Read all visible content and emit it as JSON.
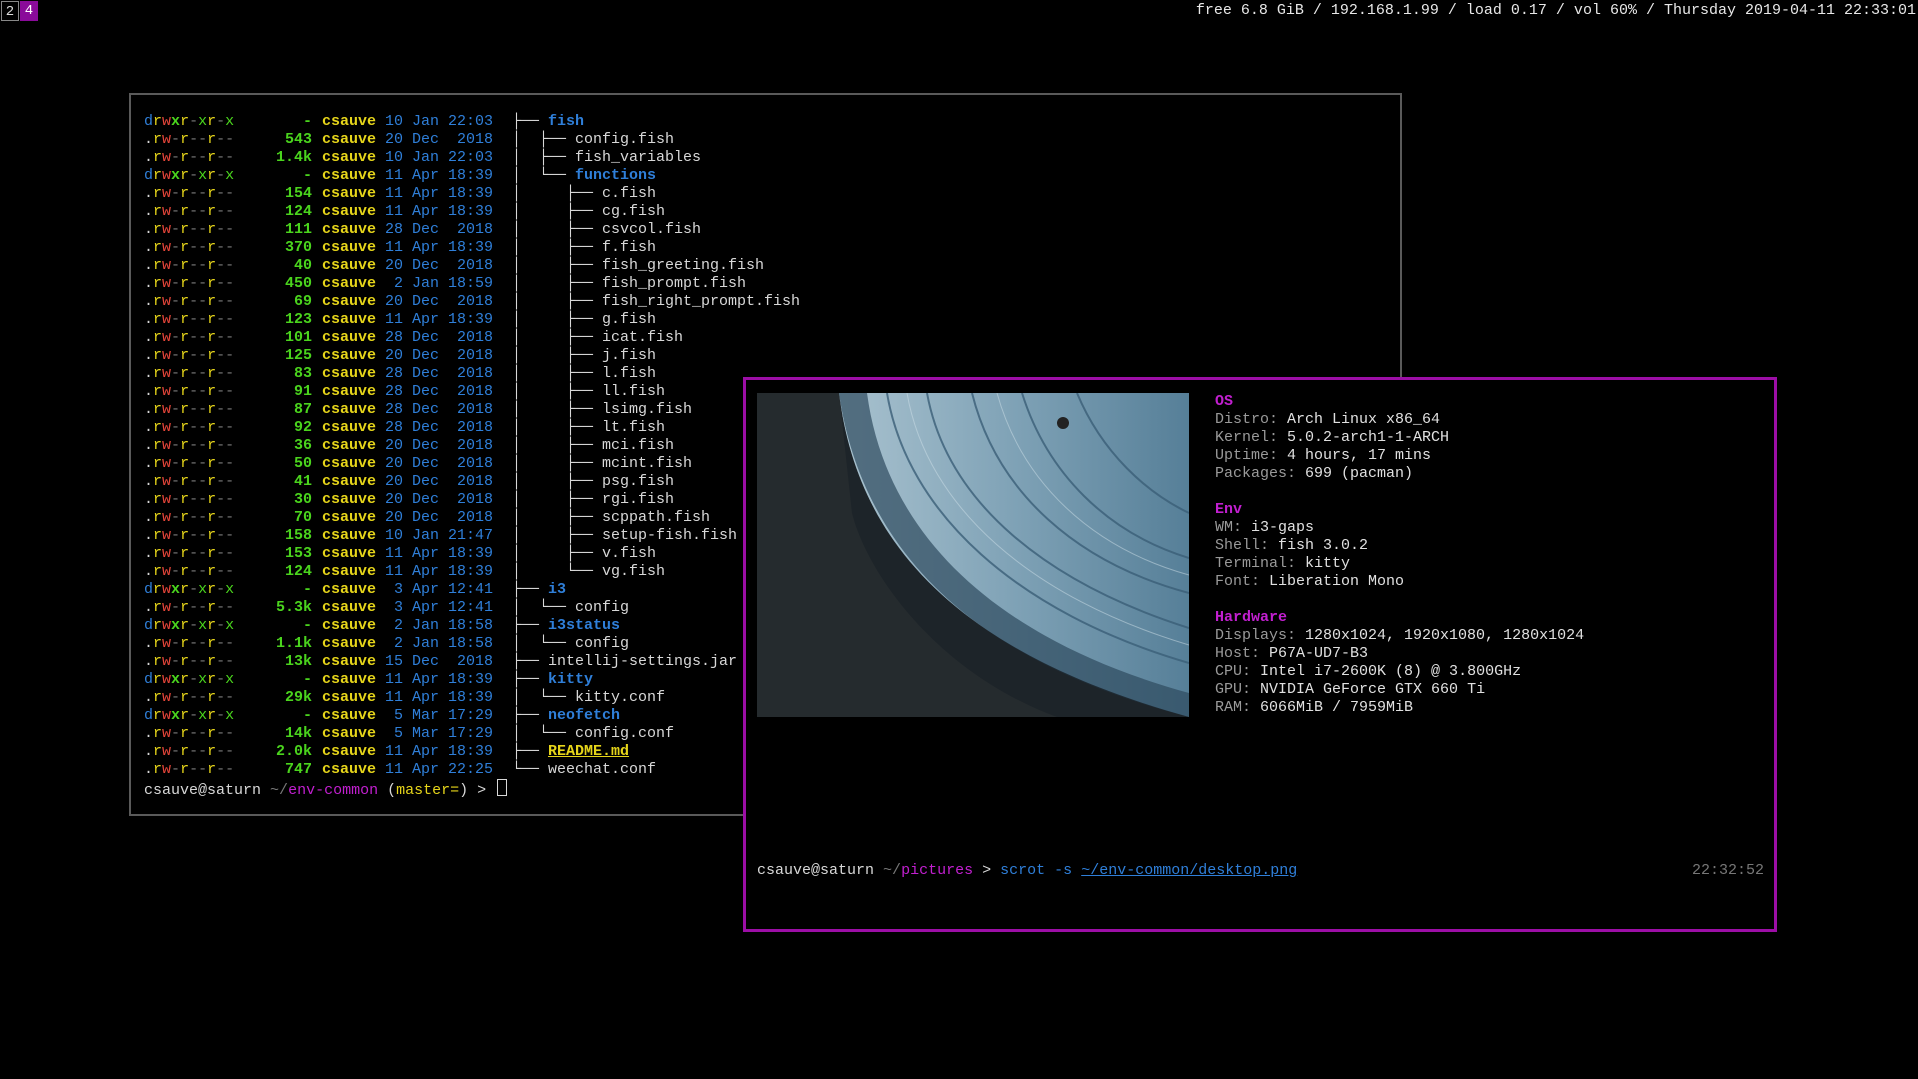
{
  "bar": {
    "workspaces": [
      "2",
      "4"
    ],
    "status": "free 6.8 GiB / 192.168.1.99 / load 0.17 / vol 60% / Thursday 2019-04-11 22:33:01"
  },
  "term1": {
    "rows": [
      {
        "perm": "drwxr-xr-x",
        "size": "-",
        "user": "csauve",
        "date": "10 Jan 22:03",
        "tree": "├── ",
        "name": "fish",
        "kind": "dir"
      },
      {
        "perm": ".rw-r--r--",
        "size": "543",
        "user": "csauve",
        "date": "20 Dec  2018",
        "tree": "│  ├── ",
        "name": "config.fish",
        "kind": "file"
      },
      {
        "perm": ".rw-r--r--",
        "size": "1.4k",
        "user": "csauve",
        "date": "10 Jan 22:03",
        "tree": "│  ├── ",
        "name": "fish_variables",
        "kind": "file"
      },
      {
        "perm": "drwxr-xr-x",
        "size": "-",
        "user": "csauve",
        "date": "11 Apr 18:39",
        "tree": "│  └── ",
        "name": "functions",
        "kind": "dir"
      },
      {
        "perm": ".rw-r--r--",
        "size": "154",
        "user": "csauve",
        "date": "11 Apr 18:39",
        "tree": "│     ├── ",
        "name": "c.fish",
        "kind": "file"
      },
      {
        "perm": ".rw-r--r--",
        "size": "124",
        "user": "csauve",
        "date": "11 Apr 18:39",
        "tree": "│     ├── ",
        "name": "cg.fish",
        "kind": "file"
      },
      {
        "perm": ".rw-r--r--",
        "size": "111",
        "user": "csauve",
        "date": "28 Dec  2018",
        "tree": "│     ├── ",
        "name": "csvcol.fish",
        "kind": "file"
      },
      {
        "perm": ".rw-r--r--",
        "size": "370",
        "user": "csauve",
        "date": "11 Apr 18:39",
        "tree": "│     ├── ",
        "name": "f.fish",
        "kind": "file"
      },
      {
        "perm": ".rw-r--r--",
        "size": "40",
        "user": "csauve",
        "date": "20 Dec  2018",
        "tree": "│     ├── ",
        "name": "fish_greeting.fish",
        "kind": "file"
      },
      {
        "perm": ".rw-r--r--",
        "size": "450",
        "user": "csauve",
        "date": " 2 Jan 18:59",
        "tree": "│     ├── ",
        "name": "fish_prompt.fish",
        "kind": "file"
      },
      {
        "perm": ".rw-r--r--",
        "size": "69",
        "user": "csauve",
        "date": "20 Dec  2018",
        "tree": "│     ├── ",
        "name": "fish_right_prompt.fish",
        "kind": "file"
      },
      {
        "perm": ".rw-r--r--",
        "size": "123",
        "user": "csauve",
        "date": "11 Apr 18:39",
        "tree": "│     ├── ",
        "name": "g.fish",
        "kind": "file"
      },
      {
        "perm": ".rw-r--r--",
        "size": "101",
        "user": "csauve",
        "date": "28 Dec  2018",
        "tree": "│     ├── ",
        "name": "icat.fish",
        "kind": "file"
      },
      {
        "perm": ".rw-r--r--",
        "size": "125",
        "user": "csauve",
        "date": "20 Dec  2018",
        "tree": "│     ├── ",
        "name": "j.fish",
        "kind": "file"
      },
      {
        "perm": ".rw-r--r--",
        "size": "83",
        "user": "csauve",
        "date": "28 Dec  2018",
        "tree": "│     ├── ",
        "name": "l.fish",
        "kind": "file"
      },
      {
        "perm": ".rw-r--r--",
        "size": "91",
        "user": "csauve",
        "date": "28 Dec  2018",
        "tree": "│     ├── ",
        "name": "ll.fish",
        "kind": "file"
      },
      {
        "perm": ".rw-r--r--",
        "size": "87",
        "user": "csauve",
        "date": "28 Dec  2018",
        "tree": "│     ├── ",
        "name": "lsimg.fish",
        "kind": "file"
      },
      {
        "perm": ".rw-r--r--",
        "size": "92",
        "user": "csauve",
        "date": "28 Dec  2018",
        "tree": "│     ├── ",
        "name": "lt.fish",
        "kind": "file"
      },
      {
        "perm": ".rw-r--r--",
        "size": "36",
        "user": "csauve",
        "date": "20 Dec  2018",
        "tree": "│     ├── ",
        "name": "mci.fish",
        "kind": "file"
      },
      {
        "perm": ".rw-r--r--",
        "size": "50",
        "user": "csauve",
        "date": "20 Dec  2018",
        "tree": "│     ├── ",
        "name": "mcint.fish",
        "kind": "file"
      },
      {
        "perm": ".rw-r--r--",
        "size": "41",
        "user": "csauve",
        "date": "20 Dec  2018",
        "tree": "│     ├── ",
        "name": "psg.fish",
        "kind": "file"
      },
      {
        "perm": ".rw-r--r--",
        "size": "30",
        "user": "csauve",
        "date": "20 Dec  2018",
        "tree": "│     ├── ",
        "name": "rgi.fish",
        "kind": "file"
      },
      {
        "perm": ".rw-r--r--",
        "size": "70",
        "user": "csauve",
        "date": "20 Dec  2018",
        "tree": "│     ├── ",
        "name": "scppath.fish",
        "kind": "file"
      },
      {
        "perm": ".rw-r--r--",
        "size": "158",
        "user": "csauve",
        "date": "10 Jan 21:47",
        "tree": "│     ├── ",
        "name": "setup-fish.fish",
        "kind": "file"
      },
      {
        "perm": ".rw-r--r--",
        "size": "153",
        "user": "csauve",
        "date": "11 Apr 18:39",
        "tree": "│     ├── ",
        "name": "v.fish",
        "kind": "file"
      },
      {
        "perm": ".rw-r--r--",
        "size": "124",
        "user": "csauve",
        "date": "11 Apr 18:39",
        "tree": "│     └── ",
        "name": "vg.fish",
        "kind": "file"
      },
      {
        "perm": "drwxr-xr-x",
        "size": "-",
        "user": "csauve",
        "date": " 3 Apr 12:41",
        "tree": "├── ",
        "name": "i3",
        "kind": "dir"
      },
      {
        "perm": ".rw-r--r--",
        "size": "5.3k",
        "user": "csauve",
        "date": " 3 Apr 12:41",
        "tree": "│  └── ",
        "name": "config",
        "kind": "file"
      },
      {
        "perm": "drwxr-xr-x",
        "size": "-",
        "user": "csauve",
        "date": " 2 Jan 18:58",
        "tree": "├── ",
        "name": "i3status",
        "kind": "dir"
      },
      {
        "perm": ".rw-r--r--",
        "size": "1.1k",
        "user": "csauve",
        "date": " 2 Jan 18:58",
        "tree": "│  └── ",
        "name": "config",
        "kind": "file"
      },
      {
        "perm": ".rw-r--r--",
        "size": "13k",
        "user": "csauve",
        "date": "15 Dec  2018",
        "tree": "├── ",
        "name": "intellij-settings.jar",
        "kind": "file"
      },
      {
        "perm": "drwxr-xr-x",
        "size": "-",
        "user": "csauve",
        "date": "11 Apr 18:39",
        "tree": "├── ",
        "name": "kitty",
        "kind": "dir"
      },
      {
        "perm": ".rw-r--r--",
        "size": "29k",
        "user": "csauve",
        "date": "11 Apr 18:39",
        "tree": "│  └── ",
        "name": "kitty.conf",
        "kind": "file"
      },
      {
        "perm": "drwxr-xr-x",
        "size": "-",
        "user": "csauve",
        "date": " 5 Mar 17:29",
        "tree": "├── ",
        "name": "neofetch",
        "kind": "dir"
      },
      {
        "perm": ".rw-r--r--",
        "size": "14k",
        "user": "csauve",
        "date": " 5 Mar 17:29",
        "tree": "│  └── ",
        "name": "config.conf",
        "kind": "file"
      },
      {
        "perm": ".rw-r--r--",
        "size": "2.0k",
        "user": "csauve",
        "date": "11 Apr 18:39",
        "tree": "├── ",
        "name": "README.md",
        "kind": "readme"
      },
      {
        "perm": ".rw-r--r--",
        "size": "747",
        "user": "csauve",
        "date": "11 Apr 22:25",
        "tree": "└── ",
        "name": "weechat.conf",
        "kind": "file"
      }
    ],
    "prompt": {
      "user": "csauve@saturn",
      "tilde": "~/",
      "path": "env-common",
      "branch_open": "(",
      "branch": "master=",
      "branch_close": ")",
      "arrow": ">"
    }
  },
  "term2": {
    "neofetch": [
      {
        "heading": "OS"
      },
      {
        "key": "Distro",
        "value": "Arch Linux x86_64"
      },
      {
        "key": "Kernel",
        "value": "5.0.2-arch1-1-ARCH"
      },
      {
        "key": "Uptime",
        "value": "4 hours, 17 mins"
      },
      {
        "key": "Packages",
        "value": "699 (pacman)"
      },
      {
        "blank": true
      },
      {
        "heading": "Env"
      },
      {
        "key": "WM",
        "value": "i3-gaps"
      },
      {
        "key": "Shell",
        "value": "fish 3.0.2"
      },
      {
        "key": "Terminal",
        "value": "kitty"
      },
      {
        "key": "Font",
        "value": "Liberation Mono"
      },
      {
        "blank": true
      },
      {
        "heading": "Hardware"
      },
      {
        "key": "Displays",
        "value": "1280x1024, 1920x1080, 1280x1024"
      },
      {
        "key": "Host",
        "value": "P67A-UD7-B3"
      },
      {
        "key": "CPU",
        "value": "Intel i7-2600K (8) @ 3.800GHz"
      },
      {
        "key": "GPU",
        "value": "NVIDIA GeForce GTX 660 Ti"
      },
      {
        "key": "RAM",
        "value": "6066MiB / 7959MiB"
      }
    ],
    "prompt": {
      "user": "csauve@saturn",
      "tilde": "~/",
      "path": "pictures",
      "arrow": ">",
      "cmd": "scrot",
      "flag": "-s",
      "arg": "~/env-common/desktop.png"
    },
    "right_time": "22:32:52"
  },
  "colors": {
    "accent": "#9c0ea6",
    "dir": "#2f7fd9",
    "user": "#e6d51a",
    "size": "#4ad41d"
  }
}
